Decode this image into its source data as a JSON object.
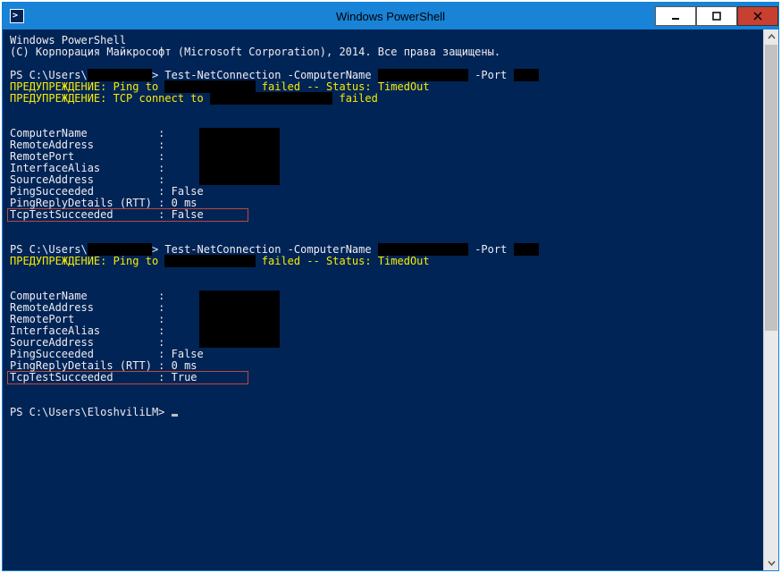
{
  "window": {
    "title": "Windows PowerShell"
  },
  "header": {
    "line1": "Windows PowerShell",
    "line2": "(C) Корпорация Майкрософт (Microsoft Corporation), 2014. Все права защищены."
  },
  "cmd1": {
    "prompt_prefix": "PS C:\\Users\\",
    "prompt_suffix": "> ",
    "command_a": "Test-NetConnection -ComputerName ",
    "command_b": " -Port ",
    "warn1a": "ПРЕДУПРЕЖДЕНИЕ: Ping to ",
    "warn1b": " failed -- Status: TimedOut",
    "warn2a": "ПРЕДУПРЕЖДЕНИЕ: TCP connect to ",
    "warn2b": " failed"
  },
  "result1": {
    "l1": "ComputerName           : ",
    "l2": "RemoteAddress          : ",
    "l3": "RemotePort             : ",
    "l4": "InterfaceAlias         : ",
    "l5": "SourceAddress          : ",
    "l6": "PingSucceeded          : False",
    "l7": "PingReplyDetails (RTT) : 0 ms",
    "l8": "TcpTestSucceeded       : False"
  },
  "cmd2": {
    "prompt_prefix": "PS C:\\Users\\",
    "prompt_suffix": "> ",
    "command_a": "Test-NetConnection -ComputerName ",
    "command_b": " -Port ",
    "warn1a": "ПРЕДУПРЕЖДЕНИЕ: Ping to ",
    "warn1b": " failed -- Status: TimedOut"
  },
  "result2": {
    "l1": "ComputerName           : ",
    "l2": "RemoteAddress          : ",
    "l3": "RemotePort             : ",
    "l4": "InterfaceAlias         : ",
    "l5": "SourceAddress          : ",
    "l6": "PingSucceeded          : False",
    "l7": "PingReplyDetails (RTT) : 0 ms",
    "l8": "TcpTestSucceeded       : True"
  },
  "final_prompt": "PS C:\\Users\\EloshviliLM> "
}
